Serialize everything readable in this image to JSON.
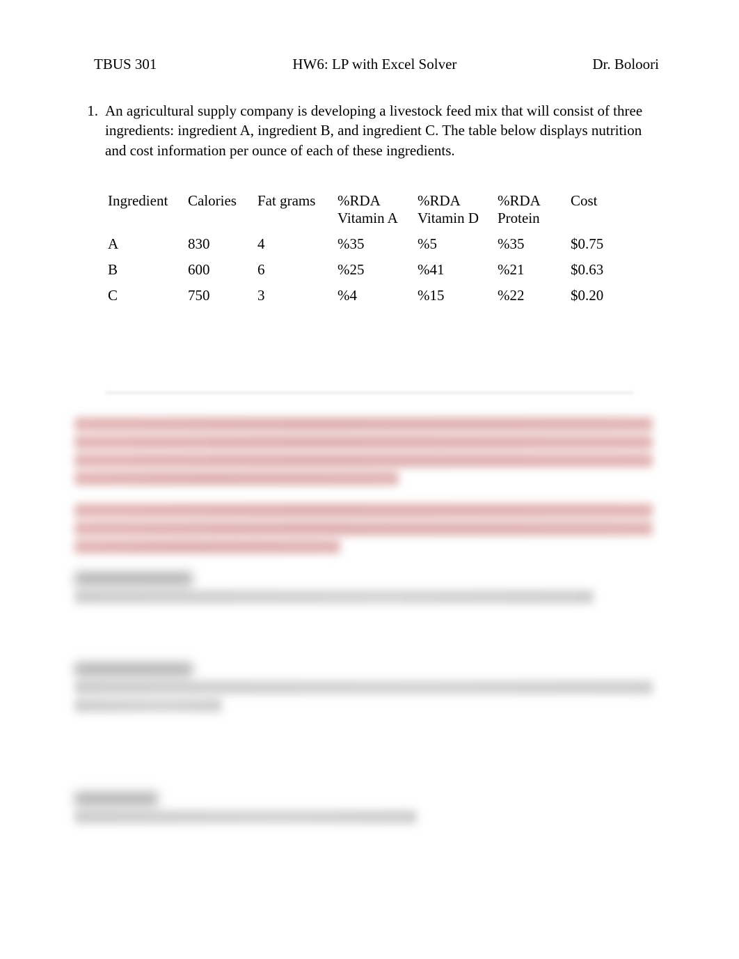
{
  "header": {
    "left": "TBUS 301",
    "center": "HW6: LP with Excel Solver",
    "right": "Dr. Boloori"
  },
  "question": {
    "number": "1.",
    "text": "An agricultural supply company is developing a livestock feed mix that will consist of three ingredients: ingredient A, ingredient B, and ingredient C. The table below displays nutrition and cost information per ounce of each of these ingredients."
  },
  "table": {
    "headers": {
      "ingredient": "Ingredient",
      "calories": "Calories",
      "fat": "Fat grams",
      "vitA_line1": "%RDA",
      "vitA_line2": "Vitamin A",
      "vitD_line1": "%RDA",
      "vitD_line2": "Vitamin D",
      "protein_line1": "%RDA",
      "protein_line2": "Protein",
      "cost": "Cost"
    },
    "rows": [
      {
        "ingredient": "A",
        "calories": "830",
        "fat": "4",
        "vitA": "%35",
        "vitD": "%5",
        "protein": "%35",
        "cost": "$0.75"
      },
      {
        "ingredient": "B",
        "calories": "600",
        "fat": "6",
        "vitA": "%25",
        "vitD": "%41",
        "protein": "%21",
        "cost": "$0.63"
      },
      {
        "ingredient": "C",
        "calories": "750",
        "fat": "3",
        "vitA": "%4",
        "vitD": "%15",
        "protein": "%22",
        "cost": "$0.20"
      }
    ]
  }
}
